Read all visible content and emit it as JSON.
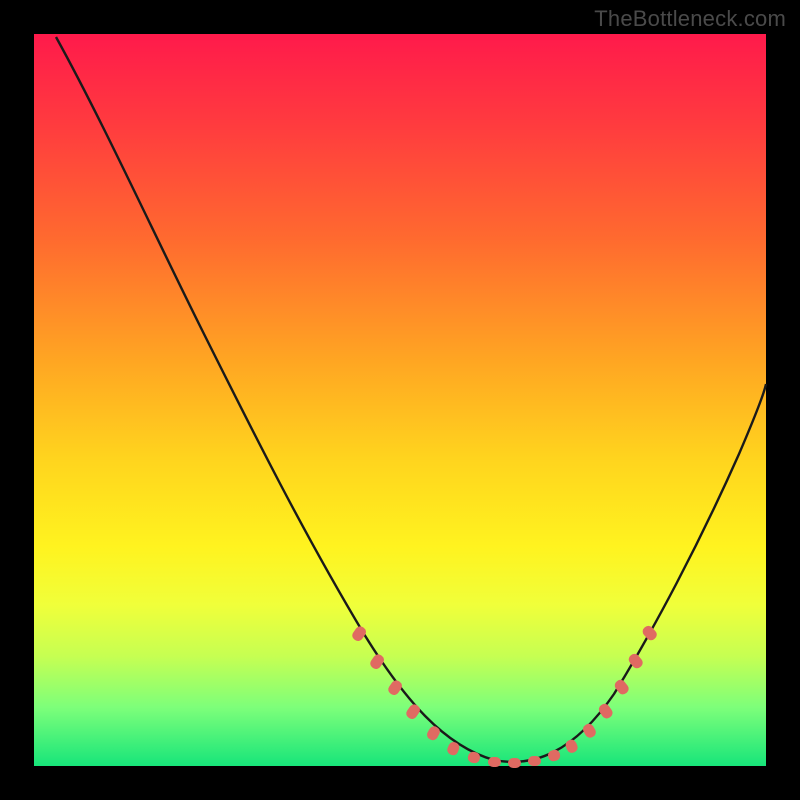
{
  "watermark": "TheBottleneck.com",
  "colors": {
    "page_bg": "#000000",
    "curve_stroke": "#1a1a1a",
    "marker_fill": "#e06a62",
    "gradient_top": "#ff1a4b",
    "gradient_bottom": "#17e57a"
  },
  "chart_data": {
    "type": "line",
    "title": "",
    "xlabel": "",
    "ylabel": "",
    "xlim": [
      0,
      100
    ],
    "ylim": [
      0,
      100
    ],
    "grid": false,
    "legend": false,
    "series": [
      {
        "name": "bottleneck-curve",
        "x": [
          3,
          8,
          14,
          20,
          26,
          32,
          38,
          44,
          50,
          54,
          58,
          62,
          66,
          70,
          74,
          78,
          82,
          86,
          90,
          94,
          98,
          100
        ],
        "y": [
          99,
          90,
          80,
          70,
          60,
          50,
          40,
          30,
          20,
          12,
          6,
          2,
          0,
          0,
          2,
          6,
          12,
          20,
          30,
          40,
          50,
          56
        ]
      }
    ],
    "markers": {
      "name": "highlight-dots",
      "x": [
        45,
        48,
        50,
        52,
        55,
        58,
        60,
        62,
        64,
        66,
        68,
        70,
        72,
        74,
        76,
        78,
        80,
        82,
        84
      ],
      "y": [
        28,
        22,
        18,
        14,
        9,
        5,
        3,
        1,
        0,
        0,
        0,
        0,
        1,
        2,
        4,
        7,
        11,
        16,
        21
      ]
    }
  }
}
